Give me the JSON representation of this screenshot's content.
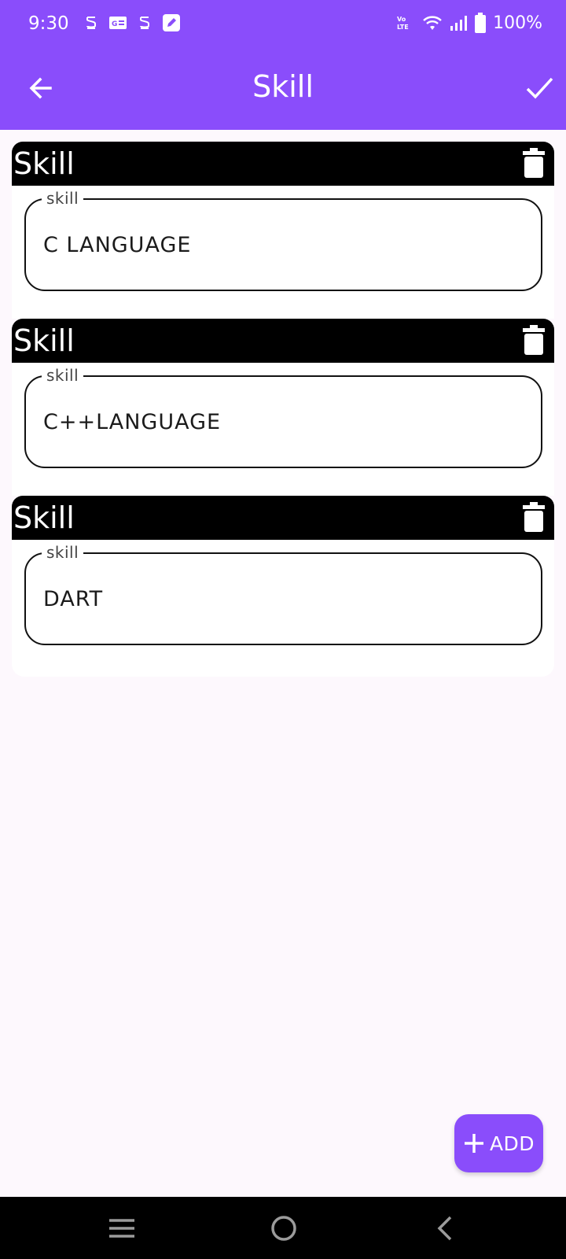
{
  "status_bar": {
    "time": "9:30",
    "battery": "100%",
    "notification_icons": [
      "s-icon",
      "id-card-icon",
      "s-icon",
      "pen-icon"
    ],
    "right_icons": [
      "volte-icon",
      "wifi-icon",
      "signal-icon",
      "battery-icon"
    ]
  },
  "app_bar": {
    "title": "Skill",
    "back_icon": "arrow-left-icon",
    "confirm_icon": "check-icon"
  },
  "skills": [
    {
      "header": "Skill",
      "label": "skill",
      "value": "C LANGUAGE"
    },
    {
      "header": "Skill",
      "label": "skill",
      "value": "C++LANGUAGE"
    },
    {
      "header": "Skill",
      "label": "skill",
      "value": "DART"
    }
  ],
  "fab": {
    "label": "ADD",
    "icon": "plus-icon"
  },
  "nav_bar": {
    "icons": [
      "menu-icon",
      "home-icon",
      "back-icon"
    ]
  },
  "colors": {
    "primary": "#8A4DFB",
    "background": "#FDF8FD",
    "card_header": "#000000"
  }
}
